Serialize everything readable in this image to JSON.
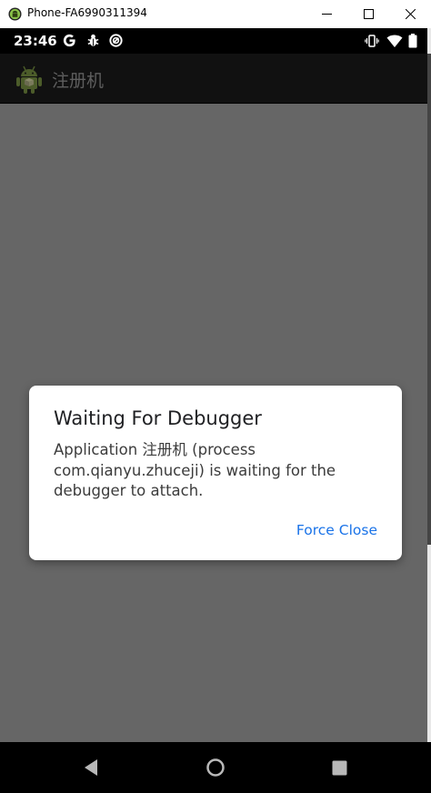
{
  "window": {
    "title": "Phone-FA6990311394"
  },
  "status_bar": {
    "time": "23:46",
    "left_icons": [
      "google-icon",
      "bug-icon",
      "sync-icon"
    ],
    "right_icons": [
      "vibrate-icon",
      "wifi-icon",
      "battery-icon"
    ]
  },
  "app_bar": {
    "title": "注册机"
  },
  "dialog": {
    "title": "Waiting For Debugger",
    "message": "Application 注册机 (process com.qianyu.zhuceji) is waiting for the debugger to attach.",
    "button_label": "Force Close"
  },
  "nav_bar": {
    "icons": [
      "back-icon",
      "home-icon",
      "recents-icon"
    ]
  },
  "colors": {
    "scrim": "#666666",
    "accent": "#1a73e8",
    "app_bar": "#111111"
  }
}
